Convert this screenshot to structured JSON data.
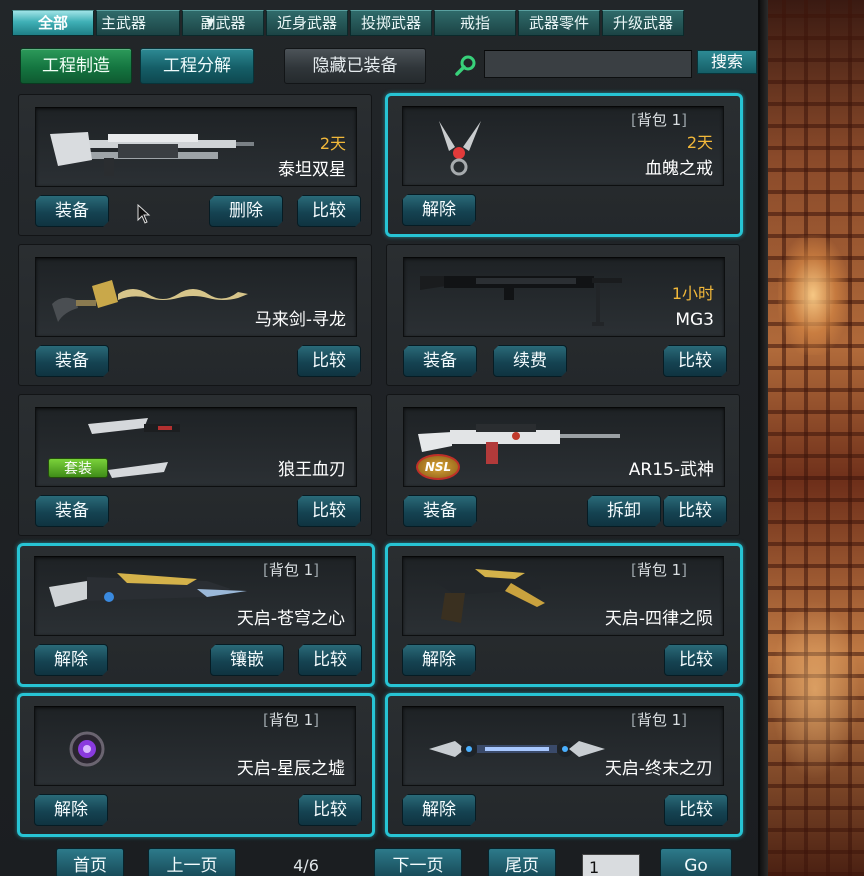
{
  "tabs": [
    {
      "label": "全部",
      "active": true
    },
    {
      "label": "主武器",
      "dropdown": true
    },
    {
      "label": "副武器"
    },
    {
      "label": "近身武器"
    },
    {
      "label": "投掷武器"
    },
    {
      "label": "戒指"
    },
    {
      "label": "武器零件"
    },
    {
      "label": "升级武器"
    }
  ],
  "toolbar": {
    "craft_label": "工程制造",
    "decompose_label": "工程分解",
    "hide_equipped_label": "隐藏已装备",
    "search_placeholder": "",
    "search_value": "",
    "search_button": "搜索"
  },
  "items": [
    {
      "name": "泰坦双星",
      "time": "2天",
      "equipped": false,
      "icon": "twin-rifle-icon",
      "buttons": [
        "装备",
        "删除",
        "比较"
      ]
    },
    {
      "name": "血魄之戒",
      "time": "2天",
      "equipped": true,
      "bag": "背包 1",
      "icon": "blood-ring-icon",
      "buttons": [
        "解除"
      ]
    },
    {
      "name": "马来剑-寻龙",
      "equipped": false,
      "icon": "kris-sword-icon",
      "buttons": [
        "装备",
        "比较"
      ]
    },
    {
      "name": "MG3",
      "time": "1小时",
      "equipped": false,
      "icon": "machine-gun-icon",
      "buttons": [
        "装备",
        "续费",
        "比较"
      ]
    },
    {
      "name": "狼王血刃",
      "equipped": false,
      "set_badge": "套装",
      "icon": "wolf-blades-icon",
      "buttons": [
        "装备",
        "比较"
      ]
    },
    {
      "name": "AR15-武神",
      "equipped": false,
      "icon": "assault-rifle-icon",
      "emblem": "NSL",
      "buttons": [
        "装备",
        "拆卸",
        "比较"
      ]
    },
    {
      "name": "天启-苍穹之心",
      "equipped": true,
      "bag": "背包 1",
      "icon": "apocalypse-rifle-icon",
      "buttons": [
        "解除",
        "镶嵌",
        "比较"
      ]
    },
    {
      "name": "天启-四律之陨",
      "equipped": true,
      "bag": "背包 1",
      "icon": "apocalypse-pistol-icon",
      "buttons": [
        "解除",
        "比较"
      ]
    },
    {
      "name": "天启-星辰之墟",
      "equipped": true,
      "bag": "背包 1",
      "icon": "star-orb-icon",
      "buttons": [
        "解除",
        "比较"
      ]
    },
    {
      "name": "天启-终末之刃",
      "equipped": true,
      "bag": "背包 1",
      "icon": "double-blade-icon",
      "buttons": [
        "解除",
        "比较"
      ]
    }
  ],
  "pager": {
    "first": "首页",
    "prev": "上一页",
    "indicator": "4/6",
    "next": "下一页",
    "last": "尾页",
    "page_input": "1",
    "go": "Go"
  },
  "colors": {
    "accent": "#27c4d4",
    "time_text": "#f2b83a",
    "tab_active": "#3fb0b6",
    "craft_button": "#147540"
  }
}
